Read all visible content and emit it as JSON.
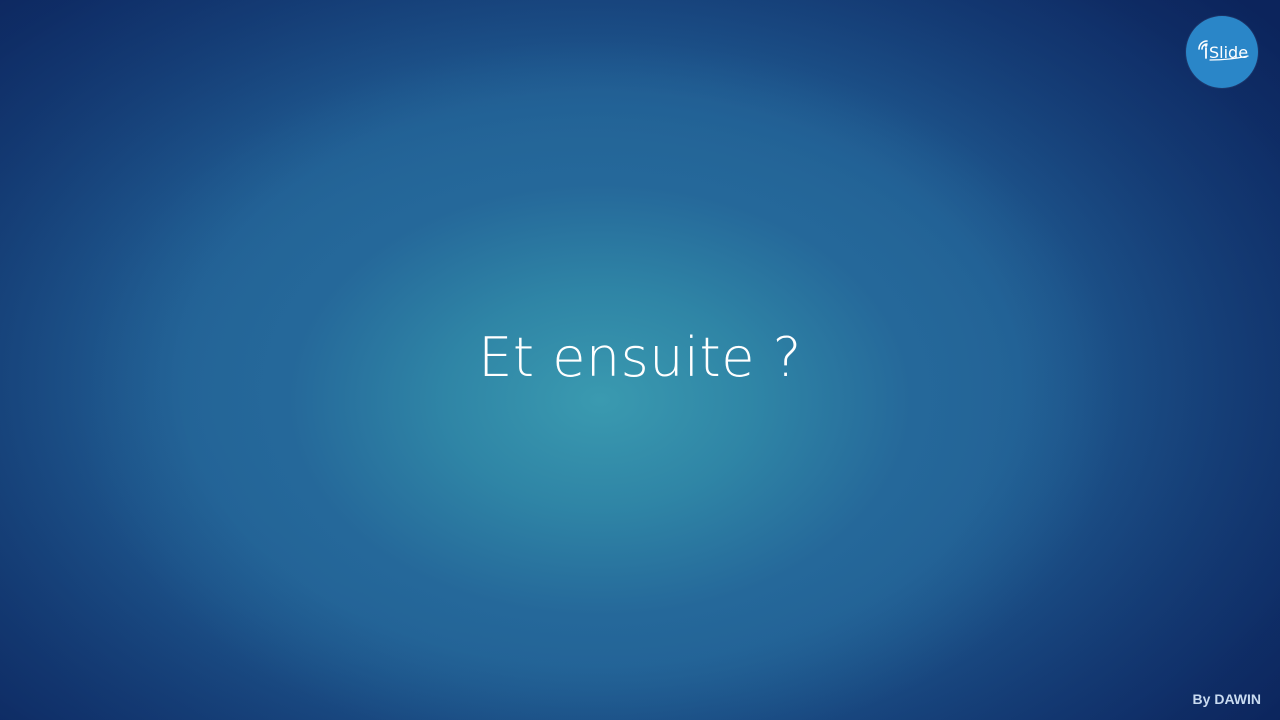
{
  "slide": {
    "title": "Et ensuite ?",
    "byline": "By DAWIN"
  },
  "logo": {
    "brand": "iSlide",
    "icon": "islide-logo-icon",
    "color": "#2a86c8"
  },
  "colors": {
    "background_center": "#3a9ab0",
    "background_edge": "#0f2b66",
    "title_text": "#ffffff"
  }
}
